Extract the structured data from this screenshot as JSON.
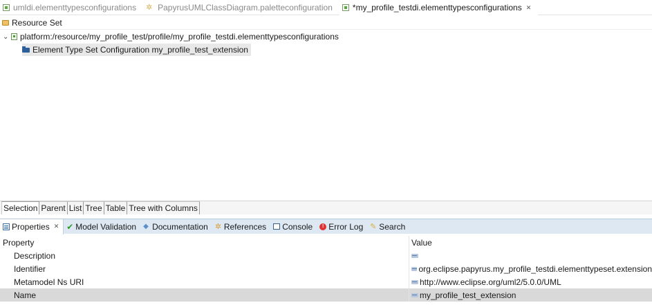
{
  "editor_tabs": [
    {
      "label": "umldi.elementtypesconfigurations",
      "icon": "model-file-icon",
      "active": false
    },
    {
      "label": "PapyrusUMLClassDiagram.paletteconfiguration",
      "icon": "palette-gear-icon",
      "active": false
    },
    {
      "label": "*my_profile_testdi.elementtypesconfigurations",
      "icon": "model-file-icon",
      "active": true,
      "close": "✕"
    }
  ],
  "resource_set": {
    "label": "Resource Set",
    "icon": "folder-icon"
  },
  "tree": {
    "root": {
      "label": "platform:/resource/my_profile_test/profile/my_profile_testdi.elementtypesconfigurations",
      "expanded": true,
      "twisty": "⌄"
    },
    "child": {
      "label": "Element Type Set Configuration my_profile_test_extension",
      "selected": true
    }
  },
  "selection_tabs": [
    "Selection",
    "Parent",
    "List",
    "Tree",
    "Table",
    "Tree with Columns"
  ],
  "view_tabs": [
    {
      "label": "Properties",
      "icon": "properties-icon",
      "active": true,
      "close": "✕"
    },
    {
      "label": "Model Validation",
      "icon": "check-icon"
    },
    {
      "label": "Documentation",
      "icon": "documentation-icon"
    },
    {
      "label": "References",
      "icon": "references-icon"
    },
    {
      "label": "Console",
      "icon": "console-icon"
    },
    {
      "label": "Error Log",
      "icon": "error-log-icon"
    },
    {
      "label": "Search",
      "icon": "search-icon"
    }
  ],
  "properties": {
    "header": {
      "property": "Property",
      "value": "Value"
    },
    "rows": [
      {
        "property": "Description",
        "value": ""
      },
      {
        "property": "Identifier",
        "value": "org.eclipse.papyrus.my_profile_testdi.elementtypeset.extension"
      },
      {
        "property": "Metamodel Ns URI",
        "value": "http://www.eclipse.org/uml2/5.0.0/UML"
      },
      {
        "property": "Name",
        "value": "my_profile_test_extension",
        "selected": true
      }
    ]
  }
}
